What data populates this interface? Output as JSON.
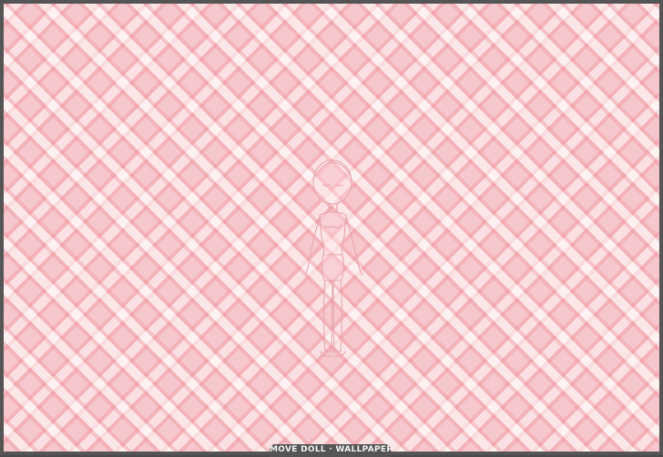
{
  "scene": {
    "background_pattern": "pink-gingham",
    "colors": {
      "frame": "#555555",
      "background": "#f6c7cc",
      "check_line": "#f08c96",
      "doll_outline": "#e8a9b0"
    }
  },
  "doll": {
    "icon": "doll-base-figure"
  },
  "wallpaper_tab": {
    "label": "MOVE DOLL · WALLPAPER"
  }
}
